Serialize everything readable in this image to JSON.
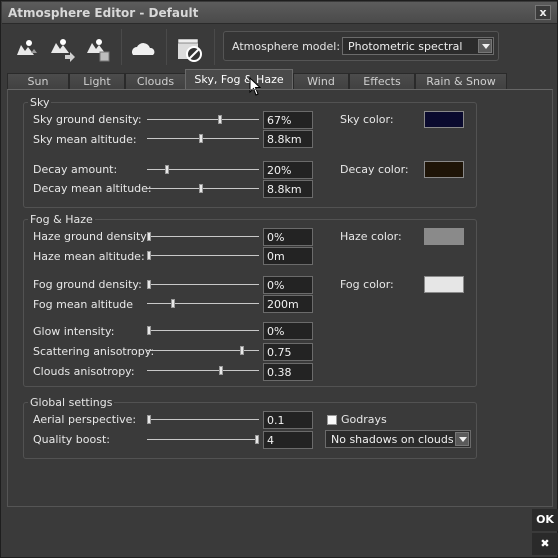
{
  "window": {
    "title": "Atmosphere Editor - Default",
    "close": "x"
  },
  "toolbar": {
    "icons": [
      "load-preset-icon",
      "save-preset-icon",
      "manage-presets-icon",
      "cloud-icon",
      "reset-clapper-icon"
    ],
    "model_label": "Atmosphere model:",
    "model_value": "Photometric spectral"
  },
  "tabs": [
    "Sun",
    "Light",
    "Clouds",
    "Sky, Fog & Haze",
    "Wind",
    "Effects",
    "Rain & Snow"
  ],
  "active_tab": "Sky, Fog & Haze",
  "sky": {
    "title": "Sky",
    "ground_density": {
      "label": "Sky ground density:",
      "value": "67%",
      "level": 0.65
    },
    "mean_altitude": {
      "label": "Sky mean altitude:",
      "value": "8.8km",
      "level": 0.48
    },
    "decay_amount": {
      "label": "Decay amount:",
      "value": "20%",
      "level": 0.18
    },
    "decay_altitude": {
      "label": "Decay mean altitude:",
      "value": "8.8km",
      "level": 0.48
    },
    "sky_color": {
      "label": "Sky color:",
      "color": "#0a0a2e"
    },
    "decay_color": {
      "label": "Decay color:",
      "color": "#1e1407"
    }
  },
  "fog": {
    "title": "Fog & Haze",
    "haze_density": {
      "label": "Haze ground density:",
      "value": "0%",
      "level": 0.0
    },
    "haze_altitude": {
      "label": "Haze mean altitude:",
      "value": "0m",
      "level": 0.0
    },
    "fog_density": {
      "label": "Fog ground density:",
      "value": "0%",
      "level": 0.0
    },
    "fog_altitude": {
      "label": "Fog mean altitude",
      "value": "200m",
      "level": 0.23
    },
    "glow": {
      "label": "Glow intensity:",
      "value": "0%",
      "level": 0.0
    },
    "scattering": {
      "label": "Scattering anisotropy:",
      "value": "0.75",
      "level": 0.85
    },
    "clouds_aniso": {
      "label": "Clouds anisotropy:",
      "value": "0.38",
      "level": 0.66
    },
    "haze_color": {
      "label": "Haze color:",
      "color": "#8a8a8a"
    },
    "fog_color": {
      "label": "Fog color:",
      "color": "#e6e6e6"
    }
  },
  "global": {
    "title": "Global settings",
    "aerial": {
      "label": "Aerial perspective:",
      "value": "0.1",
      "level": 0.0
    },
    "quality": {
      "label": "Quality boost:",
      "value": "4",
      "level": 1.0
    },
    "godrays": {
      "label": "Godrays",
      "checked": false
    },
    "shadows_value": "No shadows on clouds"
  },
  "buttons": {
    "ok": "OK",
    "cancel": "✖"
  }
}
